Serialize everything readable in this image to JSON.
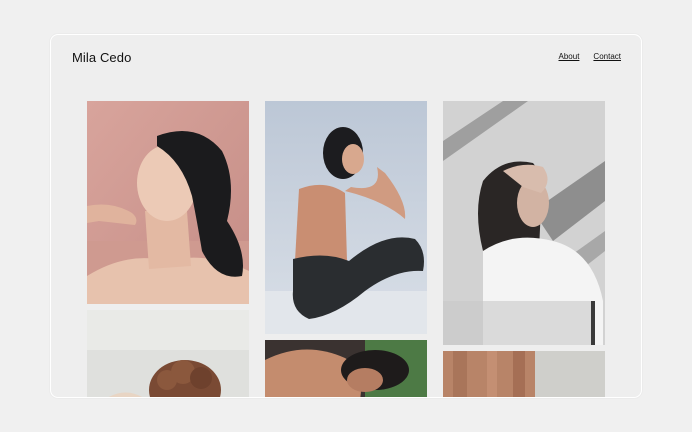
{
  "site": {
    "brand": "Mila Cedo",
    "nav": [
      "About",
      "Contact"
    ]
  },
  "gallery": {
    "columns": [
      {
        "photos": [
          {
            "name": "portrait-pink-wall"
          },
          {
            "name": "portrait-curly-hair"
          }
        ]
      },
      {
        "photos": [
          {
            "name": "portrait-seated-jeans"
          },
          {
            "name": "portrait-green-backdrop"
          }
        ]
      },
      {
        "photos": [
          {
            "name": "portrait-shadow-white-shirt"
          },
          {
            "name": "portrait-beige-drape"
          }
        ]
      }
    ]
  },
  "colors": {
    "page_bg": "#f0f0f0",
    "card_bg": "#eeeeee",
    "text": "#111111"
  }
}
